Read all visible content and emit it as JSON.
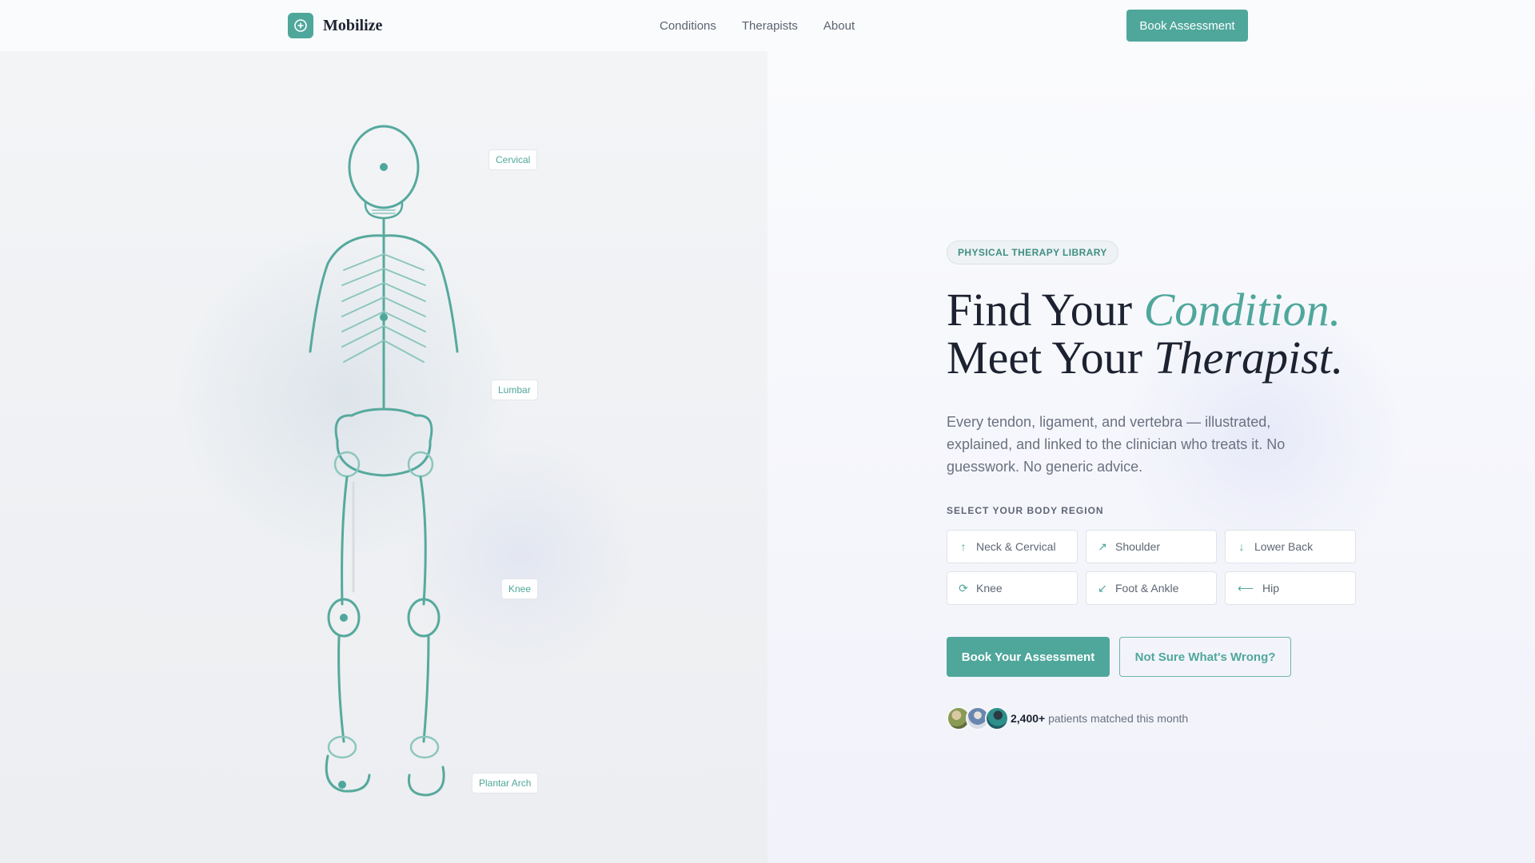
{
  "header": {
    "brand": "Mobilize",
    "logo_icon": "plus-circle-icon",
    "nav": [
      "Conditions",
      "Therapists",
      "About"
    ],
    "cta_label": "Book Assessment"
  },
  "illustration": {
    "tags": {
      "cervical": "Cervical",
      "lumbar": "Lumbar",
      "knee": "Knee",
      "plantar": "Plantar Arch"
    }
  },
  "hero": {
    "badge": "PHYSICAL THERAPY LIBRARY",
    "headline": {
      "line1_plain": "Find Your ",
      "line1_accent": "Condition.",
      "line2_plain": "Meet Your ",
      "line2_italic": "Therapist."
    },
    "lead": "Every tendon, ligament, and vertebra — illustrated, explained, and linked to the clinician who treats it. No guesswork. No generic advice.",
    "region_label": "SELECT YOUR BODY REGION",
    "regions": [
      {
        "glyph": "↑",
        "icon": "arrow-up-icon",
        "label": "Neck & Cervical"
      },
      {
        "glyph": "↗",
        "icon": "arrow-up-right-icon",
        "label": "Shoulder"
      },
      {
        "glyph": "↓",
        "icon": "arrow-down-icon",
        "label": "Lower Back"
      },
      {
        "glyph": "⟳",
        "icon": "rotate-icon",
        "label": "Knee"
      },
      {
        "glyph": "↙",
        "icon": "arrow-down-left-icon",
        "label": "Foot & Ankle"
      },
      {
        "glyph": "⟵",
        "icon": "arrow-left-long-icon",
        "label": "Hip"
      }
    ],
    "primary_cta": "Book Your Assessment",
    "secondary_cta": "Not Sure What's Wrong?",
    "proof": {
      "count": "2,400+",
      "text": " patients matched this month"
    }
  },
  "colors": {
    "accent": "#4fa79b",
    "ink": "#1c2230",
    "muted": "#6a7180"
  }
}
